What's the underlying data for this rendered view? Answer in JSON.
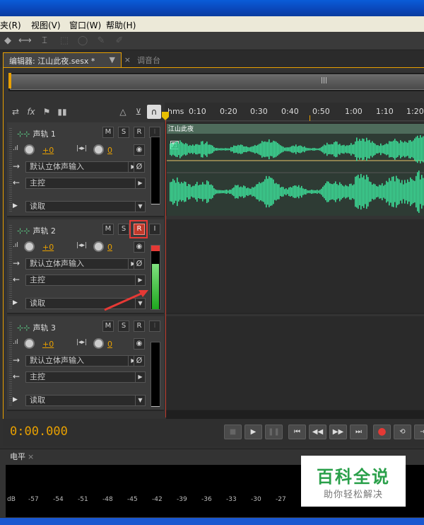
{
  "menu": [
    "夹(R)",
    "视图(V)",
    "窗口(W)",
    "帮助(H)"
  ],
  "tabs": {
    "editor": "编辑器: 江山此夜.sesx *",
    "editor_close": "×",
    "mixer": "调音台"
  },
  "ruler_ticks": [
    "hms",
    "0:10",
    "0:20",
    "0:30",
    "0:40",
    "0:50",
    "1:00",
    "1:10",
    "1:20"
  ],
  "clip": {
    "name": "江山此夜"
  },
  "tracks": [
    {
      "name": "声轨 1",
      "volume": "+0",
      "pan": "0",
      "input": "默认立体声输入",
      "output": "主控",
      "automation": "读取",
      "record_armed": false
    },
    {
      "name": "声轨 2",
      "volume": "+0",
      "pan": "0",
      "input": "默认立体声输入",
      "output": "主控",
      "automation": "读取",
      "record_armed": true,
      "meter_level": 0.78
    },
    {
      "name": "声轨 3",
      "volume": "+0",
      "pan": "0",
      "input": "默认立体声输入",
      "output": "主控",
      "automation": "读取",
      "record_armed": false
    }
  ],
  "track_buttons": {
    "mute": "M",
    "solo": "S",
    "record": "R",
    "input": "I"
  },
  "transport": {
    "timecode": "0:00.000"
  },
  "level_panel": {
    "title": "电平",
    "close": "×",
    "db_ticks": [
      "dB",
      "-57",
      "-54",
      "-51",
      "-48",
      "-45",
      "-42",
      "-39",
      "-36",
      "-33",
      "-30",
      "-27"
    ]
  },
  "watermark": {
    "title": "百科全说",
    "subtitle": "助你轻松解决"
  },
  "colors": {
    "accent": "#e8a000",
    "waveform": "#3ddc97",
    "record": "#c0392b",
    "meter": "#2ecc40"
  }
}
